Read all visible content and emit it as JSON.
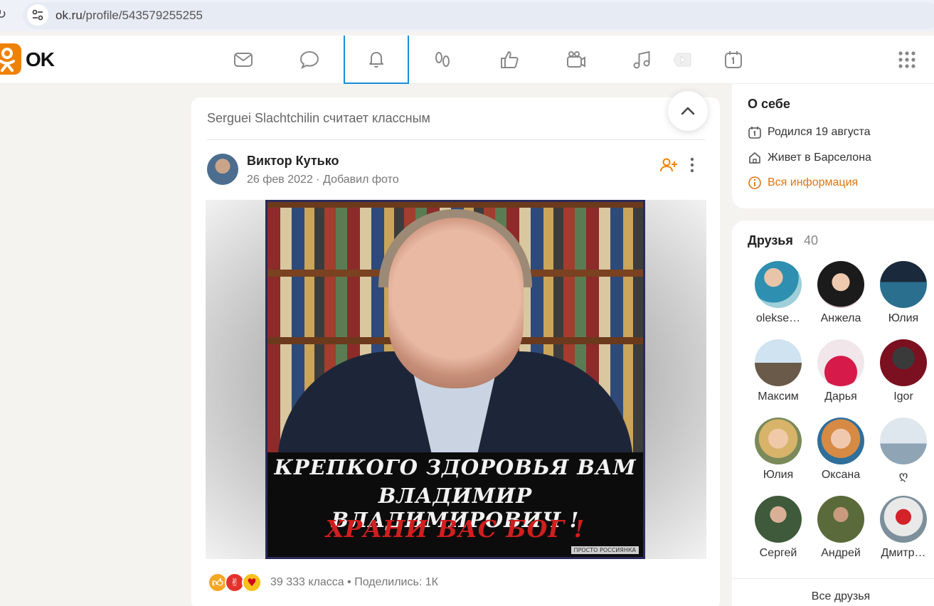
{
  "browser": {
    "reload_glyph": "↻",
    "url_domain": "ok.ru",
    "url_path": "/profile/543579255255"
  },
  "brand": {
    "name": "OK",
    "accent": "#ee8208",
    "active_tab_color": "#1a8fd8"
  },
  "nav": {
    "icons": [
      "mail-icon",
      "chat-icon",
      "bell-icon",
      "guests-icon",
      "like-icon",
      "camera-icon",
      "music-icon",
      "video-icon",
      "calendar-icon"
    ],
    "active": "bell-icon"
  },
  "feed": {
    "header": "Serguei Slachtchilin считает классным",
    "post": {
      "author": "Виктор Кутько",
      "meta": "26 фев 2022 · Добавил фото",
      "image_caption": {
        "line1": "КРЕПКОГО ЗДОРОВЬЯ ВАМ",
        "line2": "ВЛАДИМИР  ВЛАДИМИРОВИЧ !",
        "line3": "ХРАНИ ВАС БОГ !",
        "watermark": "ПРОСТО РОССИЯНКА"
      },
      "reactions": [
        "like-reaction",
        "rock-reaction",
        "love-reaction"
      ],
      "stats": "39 333 класса  •  Поделились: 1К"
    }
  },
  "about": {
    "title": "О себе",
    "birthday": "Родился 19 августа",
    "city": "Живет в Барселона",
    "all_info": "Вся информация"
  },
  "friends": {
    "title": "Друзья",
    "count": "40",
    "items": [
      {
        "name": "olekse…"
      },
      {
        "name": "Анжела"
      },
      {
        "name": "Юлия"
      },
      {
        "name": "Максим"
      },
      {
        "name": "Дарья"
      },
      {
        "name": "Igor"
      },
      {
        "name": "Юлия"
      },
      {
        "name": "Оксана"
      },
      {
        "name": "ღ"
      },
      {
        "name": "Сергей"
      },
      {
        "name": "Андрей"
      },
      {
        "name": "Дмитр…"
      }
    ],
    "all_label": "Все друзья"
  }
}
